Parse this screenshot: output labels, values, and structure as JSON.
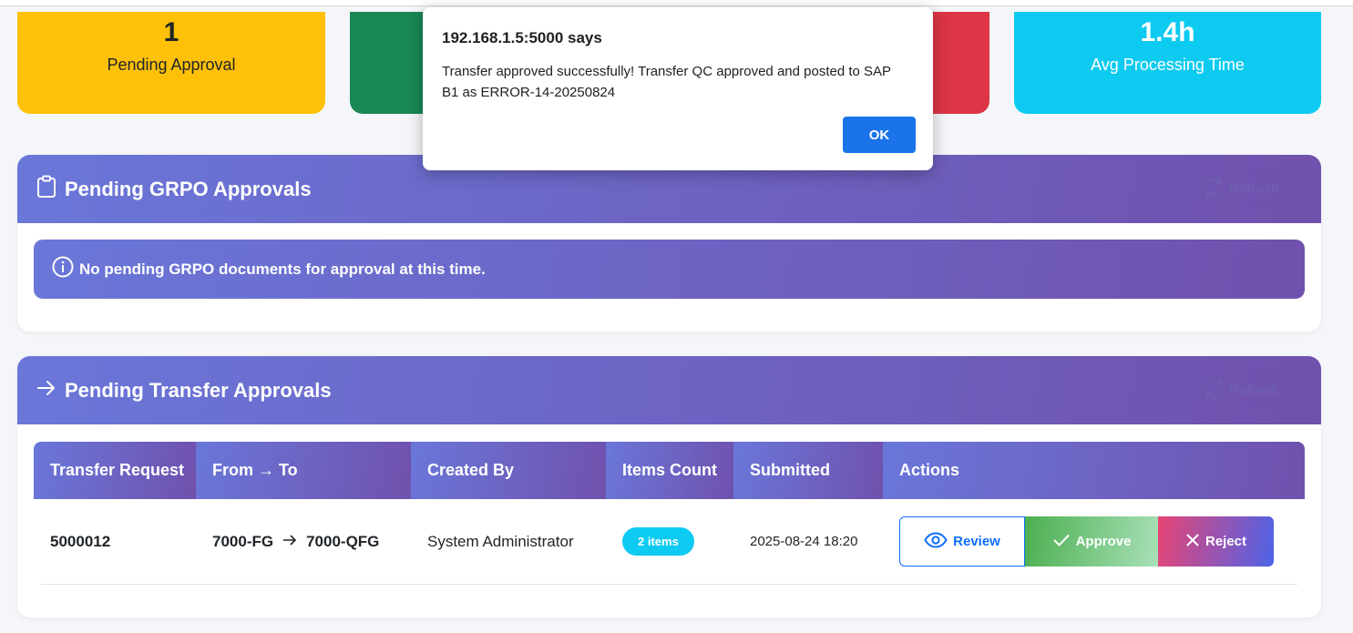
{
  "stats": [
    {
      "value": "1",
      "label": "Pending Approval",
      "color": "#ffc107"
    },
    {
      "value": "",
      "label": "",
      "color": "#198754"
    },
    {
      "value": "",
      "label": "",
      "color": "#dc3545"
    },
    {
      "value": "1.4h",
      "label": "Avg Processing Time",
      "color": "#0dcaf0"
    }
  ],
  "grpo_panel": {
    "icon": "clipboard-icon",
    "title": "Pending GRPO Approvals",
    "refresh_label": "Refresh",
    "info_icon": "info-circle-icon",
    "info_text": "No pending GRPO documents for approval at this time."
  },
  "transfer_panel": {
    "icon": "arrow-right-icon",
    "title": "Pending Transfer Approvals",
    "refresh_label": "Refresh",
    "columns": [
      "Transfer Request",
      "From → To",
      "Created By",
      "Items Count",
      "Submitted",
      "Actions"
    ],
    "rows": [
      {
        "transfer_request": "5000012",
        "from": "7000-FG",
        "to": "7000-QFG",
        "created_by": "System Administrator",
        "items_count": "2 items",
        "submitted": "2025-08-24 18:20",
        "actions": {
          "review": "Review",
          "approve": "Approve",
          "reject": "Reject"
        }
      }
    ]
  },
  "dialog": {
    "origin": "192.168.1.5:5000 says",
    "message": "Transfer approved successfully! Transfer QC approved and posted to SAP B1 as ERROR-14-20250824",
    "ok_label": "OK"
  }
}
